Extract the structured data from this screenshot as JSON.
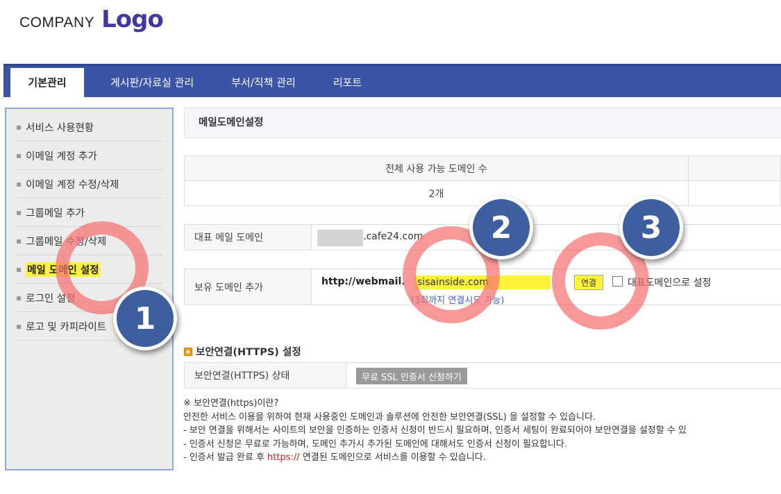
{
  "logo": {
    "company": "COMPANY",
    "mark": "Logo"
  },
  "nav": {
    "tabs": [
      {
        "label": "기본관리"
      },
      {
        "label": "게시판/자료실 관리"
      },
      {
        "label": "부서/직책 관리"
      },
      {
        "label": "리포트"
      }
    ]
  },
  "sidebar": {
    "items": [
      {
        "label": "서비스 사용현황"
      },
      {
        "label": "이메일 계정 추가"
      },
      {
        "label": "이메일 계정 수정/삭제"
      },
      {
        "label": "그룹메일 추가"
      },
      {
        "label": "그룹메일 수정/삭제"
      },
      {
        "label": "메일 도메인 설정"
      },
      {
        "label": "로그인 설정"
      },
      {
        "label": "로고 및 카피라이트"
      }
    ]
  },
  "main": {
    "title": "메일도메인설정",
    "domain_count": {
      "header": "전체 사용 가능 도메인 수",
      "value": "2개"
    },
    "primary_domain": {
      "label": "대표 메일 도메인",
      "suffix": ".cafe24.com"
    },
    "add_domain": {
      "label": "보유 도메인 추가",
      "prefix": "http://webmail.",
      "input_value": "sisainside.com",
      "connect_label": "연결",
      "checkbox_label": "대표도메인으로 설정",
      "hint": "(3회까지 연결시도 가능)"
    },
    "https": {
      "section_title": "보안연결(HTTPS) 설정",
      "status_label": "보안연결(HTTPS) 상태",
      "ssl_button": "무료 SSL 인증서 신청하기"
    },
    "notes": {
      "heading": "※ 보안연결(https)이란?",
      "line1": "안전한 서비스 이용을 위하여 현재 사용중인 도메인과 솔루션에 안전한 보안연결(SSL) 을 설정할 수 있습니다.",
      "line2": "- 보안 연결을 위해서는 사이트의 보안을 인증하는 인증서 신청이 반드시 필요하며, 인증서 세팅이 완료되어야 보안연결을 설정할 수 있",
      "line3": "- 인증서 신청은 무료로 가능하며, 도메인 추가시 추가된 도메인에 대해서도 인증서 신청이 필요합니다.",
      "line4_pre": "- 인증서 발급 완료 후 ",
      "line4_red": "https://",
      "line4_post": " 연결된 도메인으로 서비스를 이용할 수 있습니다."
    }
  },
  "annotations": {
    "badge1": "1",
    "badge2": "2",
    "badge3": "3"
  }
}
